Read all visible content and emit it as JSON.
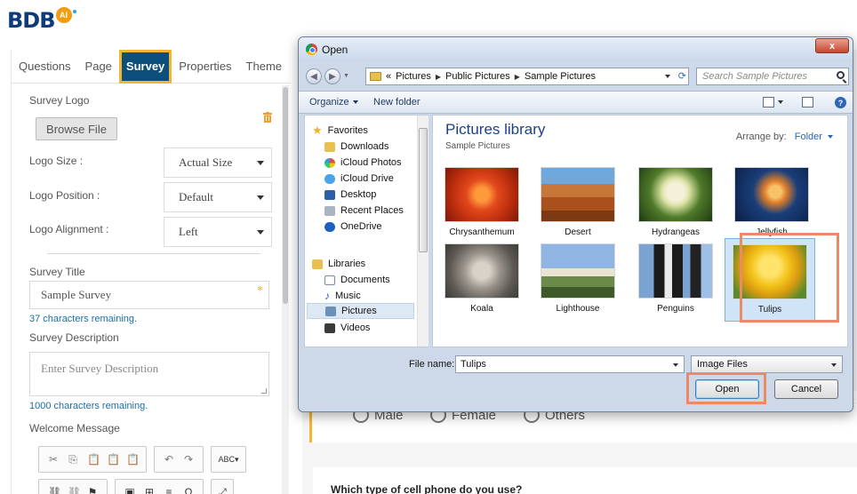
{
  "logo": {
    "wordmark": "BDB",
    "badge": "AI"
  },
  "survey_panel": {
    "tabs": [
      {
        "label": "Questions",
        "active": false
      },
      {
        "label": "Page",
        "active": false
      },
      {
        "label": "Survey",
        "active": true
      },
      {
        "label": "Properties",
        "active": false
      },
      {
        "label": "Theme",
        "active": false
      }
    ],
    "survey_logo_label": "Survey Logo",
    "browse_button": "Browse File",
    "logo_size_label": "Logo Size :",
    "logo_size_value": "Actual Size",
    "logo_position_label": "Logo Position :",
    "logo_position_value": "Default",
    "logo_alignment_label": "Logo Alignment :",
    "logo_alignment_value": "Left",
    "survey_title_label": "Survey Title",
    "survey_title_value": "Sample Survey",
    "survey_title_hint": "37 characters remaining.",
    "survey_description_label": "Survey Description",
    "survey_description_placeholder": "Enter Survey Description",
    "survey_description_hint": "1000 characters remaining.",
    "welcome_message_label": "Welcome Message",
    "editor_toolbar_row1": [
      [
        "✂",
        "⎘",
        "📋",
        "📋",
        "📋"
      ],
      [
        "↶",
        "↷"
      ],
      [
        "ABC▾"
      ]
    ],
    "editor_toolbar_row2": [
      [
        "⛓",
        "⛓",
        "⚑"
      ],
      [
        "▣",
        "⊞",
        "≡",
        "Ω"
      ],
      [
        "⤢"
      ]
    ]
  },
  "form_preview": {
    "gender_options": [
      "Male",
      "Female",
      "Others"
    ],
    "next_question": "Which type of cell phone do you use?"
  },
  "open_dialog": {
    "title": "Open",
    "close_label": "x",
    "breadcrumb": [
      "Pictures",
      "Public Pictures",
      "Sample Pictures"
    ],
    "breadcrumb_prefix": "«",
    "search_placeholder": "Search Sample Pictures",
    "organize_label": "Organize",
    "new_folder_label": "New folder",
    "nav": {
      "favorites_label": "Favorites",
      "favorites": [
        "Downloads",
        "iCloud Photos",
        "iCloud Drive",
        "Desktop",
        "Recent Places",
        "OneDrive"
      ],
      "libraries_label": "Libraries",
      "libraries": [
        "Documents",
        "Music",
        "Pictures",
        "Videos"
      ],
      "selected": "Pictures"
    },
    "library_title": "Pictures library",
    "library_subtitle": "Sample Pictures",
    "arrange_label": "Arrange by:",
    "arrange_value": "Folder",
    "files": [
      {
        "name": "Chrysanthemum",
        "selected": false
      },
      {
        "name": "Desert",
        "selected": false
      },
      {
        "name": "Hydrangeas",
        "selected": false
      },
      {
        "name": "Jellyfish",
        "selected": false
      },
      {
        "name": "Koala",
        "selected": false
      },
      {
        "name": "Lighthouse",
        "selected": false
      },
      {
        "name": "Penguins",
        "selected": false
      },
      {
        "name": "Tulips",
        "selected": true
      }
    ],
    "file_name_label": "File name:",
    "file_name_value": "Tulips",
    "file_type_value": "Image Files",
    "open_button": "Open",
    "cancel_button": "Cancel"
  },
  "colors": {
    "active_tab_bg": "#0d4f7c",
    "highlight": "#ec8a64",
    "accent_yellow": "#f2b630",
    "link_blue": "#1a6fa6"
  }
}
